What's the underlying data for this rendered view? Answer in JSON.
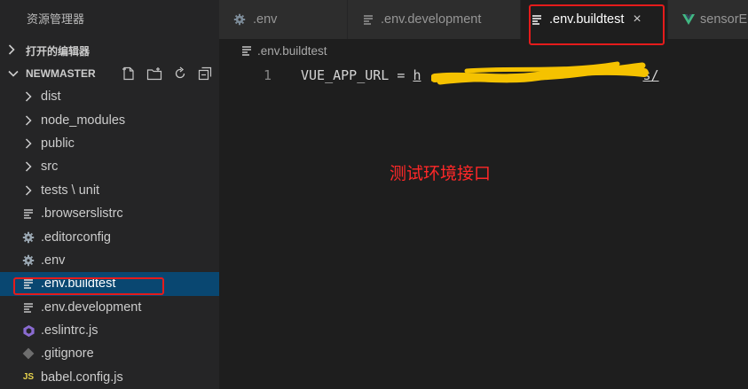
{
  "explorer": {
    "title": "资源管理器",
    "open_editors_label": "打开的编辑器",
    "project_label": "NEWMASTER",
    "actions": [
      "new-file-icon",
      "new-folder-icon",
      "refresh-icon",
      "collapse-all-icon"
    ],
    "items": [
      {
        "label": "dist",
        "type": "folder",
        "icon": "chevron-right-icon"
      },
      {
        "label": "node_modules",
        "type": "folder",
        "icon": "chevron-right-icon"
      },
      {
        "label": "public",
        "type": "folder",
        "icon": "chevron-right-icon"
      },
      {
        "label": "src",
        "type": "folder",
        "icon": "chevron-right-icon"
      },
      {
        "label": "tests \\ unit",
        "type": "folder",
        "icon": "chevron-right-icon"
      },
      {
        "label": ".browserslistrc",
        "type": "file",
        "icon": "lines-file-icon"
      },
      {
        "label": ".editorconfig",
        "type": "file",
        "icon": "gear-icon"
      },
      {
        "label": ".env",
        "type": "file",
        "icon": "gear-icon"
      },
      {
        "label": ".env.buildtest",
        "type": "file",
        "icon": "lines-file-icon",
        "selected": true
      },
      {
        "label": ".env.development",
        "type": "file",
        "icon": "lines-file-icon"
      },
      {
        "label": ".eslintrc.js",
        "type": "file",
        "icon": "eslint-icon"
      },
      {
        "label": ".gitignore",
        "type": "file",
        "icon": "git-icon"
      },
      {
        "label": "babel.config.js",
        "type": "file",
        "icon": "js-icon",
        "badge": "JS"
      }
    ]
  },
  "tabs": [
    {
      "label": ".env",
      "icon": "gear-icon"
    },
    {
      "label": ".env.development",
      "icon": "lines-file-icon"
    },
    {
      "label": ".env.buildtest",
      "icon": "lines-file-icon",
      "active": true,
      "close": "×"
    },
    {
      "label": "sensorE",
      "icon": "vue-icon"
    }
  ],
  "breadcrumb": {
    "label": ".env.buildtest"
  },
  "editor": {
    "line_number": "1",
    "key": "VUE_APP_URL",
    "operator": "=",
    "value_visible": "h",
    "value_tail": "s/"
  },
  "annotation": "测试环境接口",
  "colors": {
    "sidebar_bg": "#252526",
    "editor_bg": "#1e1e1e",
    "selection": "#094771",
    "highlight_red": "#e51b1b",
    "annotation_red": "#ff2828",
    "redaction_yellow": "#f5c200",
    "vue_green": "#41b883"
  }
}
